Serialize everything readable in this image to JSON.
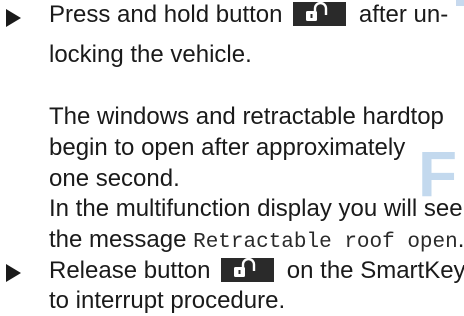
{
  "watermark": {
    "letter": "F",
    "color": "#b9d3ec"
  },
  "instructions": {
    "step1": {
      "bullet_icon": "triangle-right-icon",
      "line1_prefix": "Press and hold button",
      "line1_suffix": "after un-",
      "line2": "locking the vehicle.",
      "button_icon": "unlock-key-icon"
    },
    "result": {
      "line1": "The windows and retractable hardtop",
      "line2": "begin to open after approximately",
      "line3": "one second.",
      "line4": "In the multifunction display you will see",
      "line5_prefix": "the message",
      "message": "Retractable roof open",
      "line5_suffix": "."
    },
    "step2": {
      "bullet_icon": "triangle-right-icon",
      "line1_prefix": "Release button",
      "line1_suffix": "on the SmartKey",
      "line2": "to interrupt procedure.",
      "button_icon": "unlock-key-icon"
    }
  }
}
